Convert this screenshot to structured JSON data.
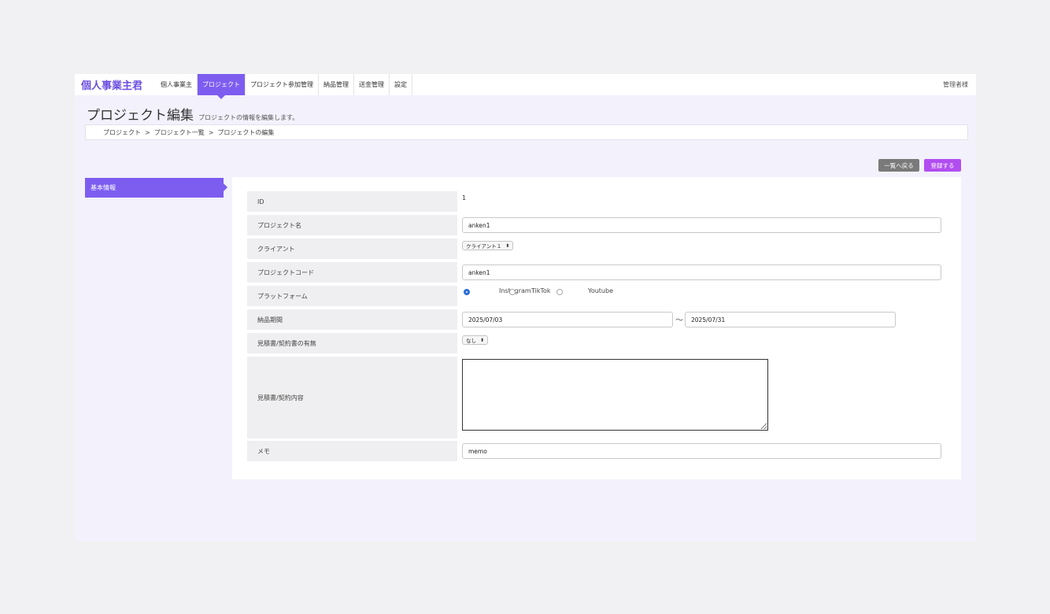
{
  "nav": {
    "brand": "個人事業主君",
    "items": [
      "個人事業主",
      "プロジェクト",
      "プロジェクト参加管理",
      "納品管理",
      "送金管理",
      "設定"
    ],
    "active_index": 1,
    "user": "管理者様"
  },
  "page": {
    "title": "プロジェクト編集",
    "subtitle": "プロジェクトの情報を編集します。",
    "breadcrumb": [
      "プロジェクト",
      "プロジェクト一覧",
      "プロジェクトの編集"
    ],
    "breadcrumb_sep": ">"
  },
  "actions": {
    "back": "一覧へ戻る",
    "save": "登録する"
  },
  "sidebar": {
    "tab": "基本情報"
  },
  "form": {
    "id": {
      "label": "ID",
      "value": "1"
    },
    "name": {
      "label": "プロジェクト名",
      "value": "anken1"
    },
    "client": {
      "label": "クライアント",
      "value": "クライアント１"
    },
    "code": {
      "label": "プロジェクトコード",
      "value": "anken1"
    },
    "platform": {
      "label": "プラットフォーム",
      "options": [
        "Instagram",
        "TikTok",
        "Youtube"
      ],
      "selected": "Instagram"
    },
    "period": {
      "label": "納品期間",
      "start": "2025/07/03",
      "end": "2025/07/31",
      "separator": "〜"
    },
    "contract_flag": {
      "label": "見積書/契約書の有無",
      "value": "なし"
    },
    "contract_content": {
      "label": "見積書/契約内容",
      "value": ""
    },
    "memo": {
      "label": "メモ",
      "value": "memo"
    }
  },
  "colors": {
    "accent": "#7d5df0",
    "save": "#b24df0",
    "back": "#7a7a7a",
    "radio": "#2c6fd6"
  }
}
